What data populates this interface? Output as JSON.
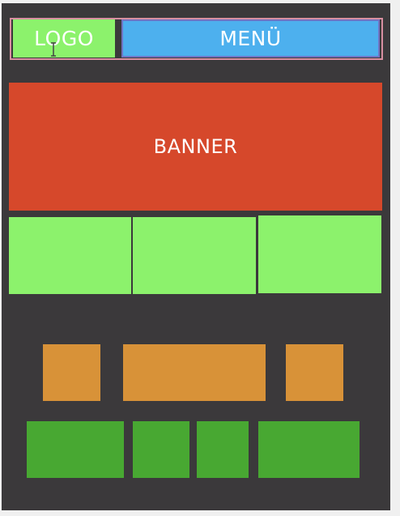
{
  "header": {
    "logo_label": "LOGO",
    "menu_label": "MENÜ"
  },
  "banner": {
    "label": "BANNER"
  },
  "colors": {
    "background": "#3b393b",
    "logo": "#8cf26c",
    "menu": "#4db0ee",
    "banner": "#d6482b",
    "content_blocks": "#8cf26c",
    "orange_blocks": "#d89238",
    "footer_blocks": "#48a832"
  },
  "icons": {
    "cursor": "text-cursor-icon"
  }
}
